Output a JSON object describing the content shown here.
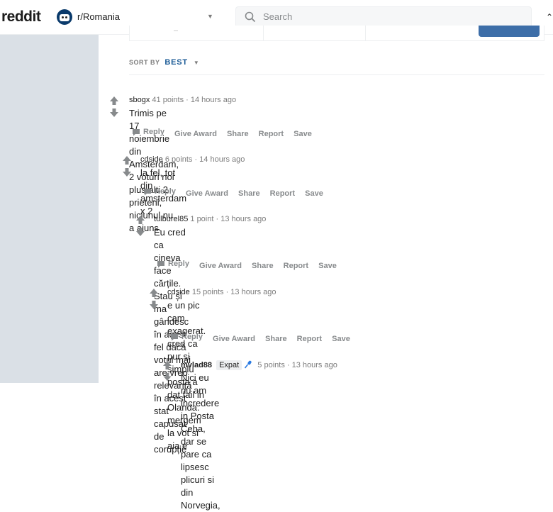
{
  "header": {
    "logo": "reddit",
    "subreddit": "r/Romania",
    "search_placeholder": "Search"
  },
  "sort": {
    "label": "SORT BY",
    "value": "BEST"
  },
  "comments": [
    {
      "user": "sbogx",
      "points": "41 points",
      "time": "14 hours ago",
      "lines": [
        "Trimis pe 17 noiembrie din Amsterdam, 2 voturi noi plus alti 2 prieteni, niciunul nu a ajuns."
      ]
    },
    {
      "user": "cdside",
      "points": "6 points",
      "time": "14 hours ago",
      "lines": [
        "la fel, tot din amsterdam x 2"
      ]
    },
    {
      "user": "tulburel85",
      "points": "1 point",
      "time": "13 hours ago",
      "lines": [
        "Eu cred ca cineva face cărțile. Stau și ma gândesc în acest fel dacă votul mai are vreo",
        "relevanță în acest stat capusat de corupție"
      ]
    },
    {
      "user": "cdside",
      "points": "15 points",
      "time": "13 hours ago",
      "lines": [
        "e un pic cam exagerat. cred ca pur si simplu posta a dat fail in Olanda. mergem la vot si",
        "aia e"
      ]
    },
    {
      "user": "mvlad88",
      "flair": "Expat",
      "points": "5 points",
      "time": "13 hours ago",
      "lines": [
        "Nici eu nu am incredere in Posta Ceha, dar se pare ca lipsesc plicuri si din Norvegia,"
      ]
    }
  ],
  "actions": {
    "reply": "Reply",
    "award": "Give Award",
    "share": "Share",
    "report": "Report",
    "save": "Save"
  }
}
